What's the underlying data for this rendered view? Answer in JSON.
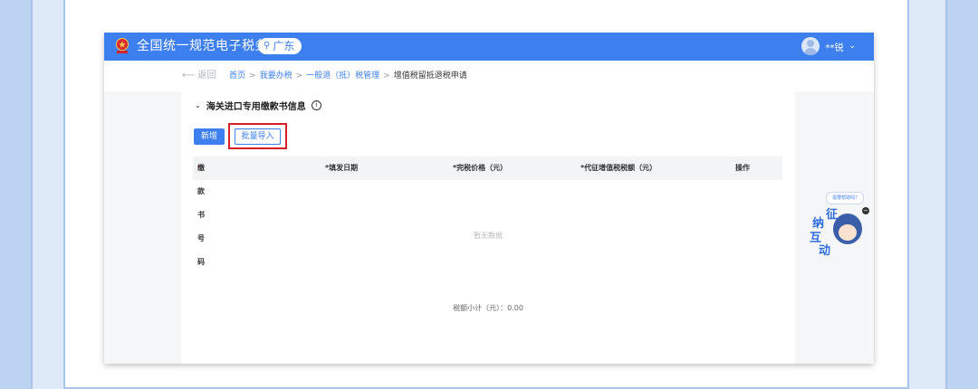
{
  "header": {
    "site_title": "全国统一规范电子税务局",
    "region": "广东",
    "user_name": "**锐",
    "brand_color": "#3e7ff0"
  },
  "breadcrumb": {
    "back_label": "返回",
    "items": [
      "首页",
      "我要办税",
      "一般退（抵）税管理",
      "增值税留抵退税申请"
    ],
    "separator": ">"
  },
  "section": {
    "title": "海关进口专用缴款书信息",
    "add_label": "新增",
    "import_label": "批量导入",
    "highlight_color": "#d61f26"
  },
  "table": {
    "columns": [
      "*缴款书号码",
      "*填发日期",
      "*完税价格（元）",
      "*代征增值税税额（元）",
      "操作"
    ],
    "empty_text": "暂无数据",
    "subtotal_text": "税额小计（元）：0.00"
  },
  "assistant": {
    "bubble_text": "需要帮助吗?",
    "chars": [
      "征",
      "纳",
      "互",
      "动"
    ]
  },
  "icons": {
    "emblem": "national-emblem-icon",
    "location": "location-pin-icon",
    "collapse": "chevron-down-icon",
    "info": "info-icon",
    "back": "arrow-left-icon",
    "user": "user-avatar-icon"
  }
}
